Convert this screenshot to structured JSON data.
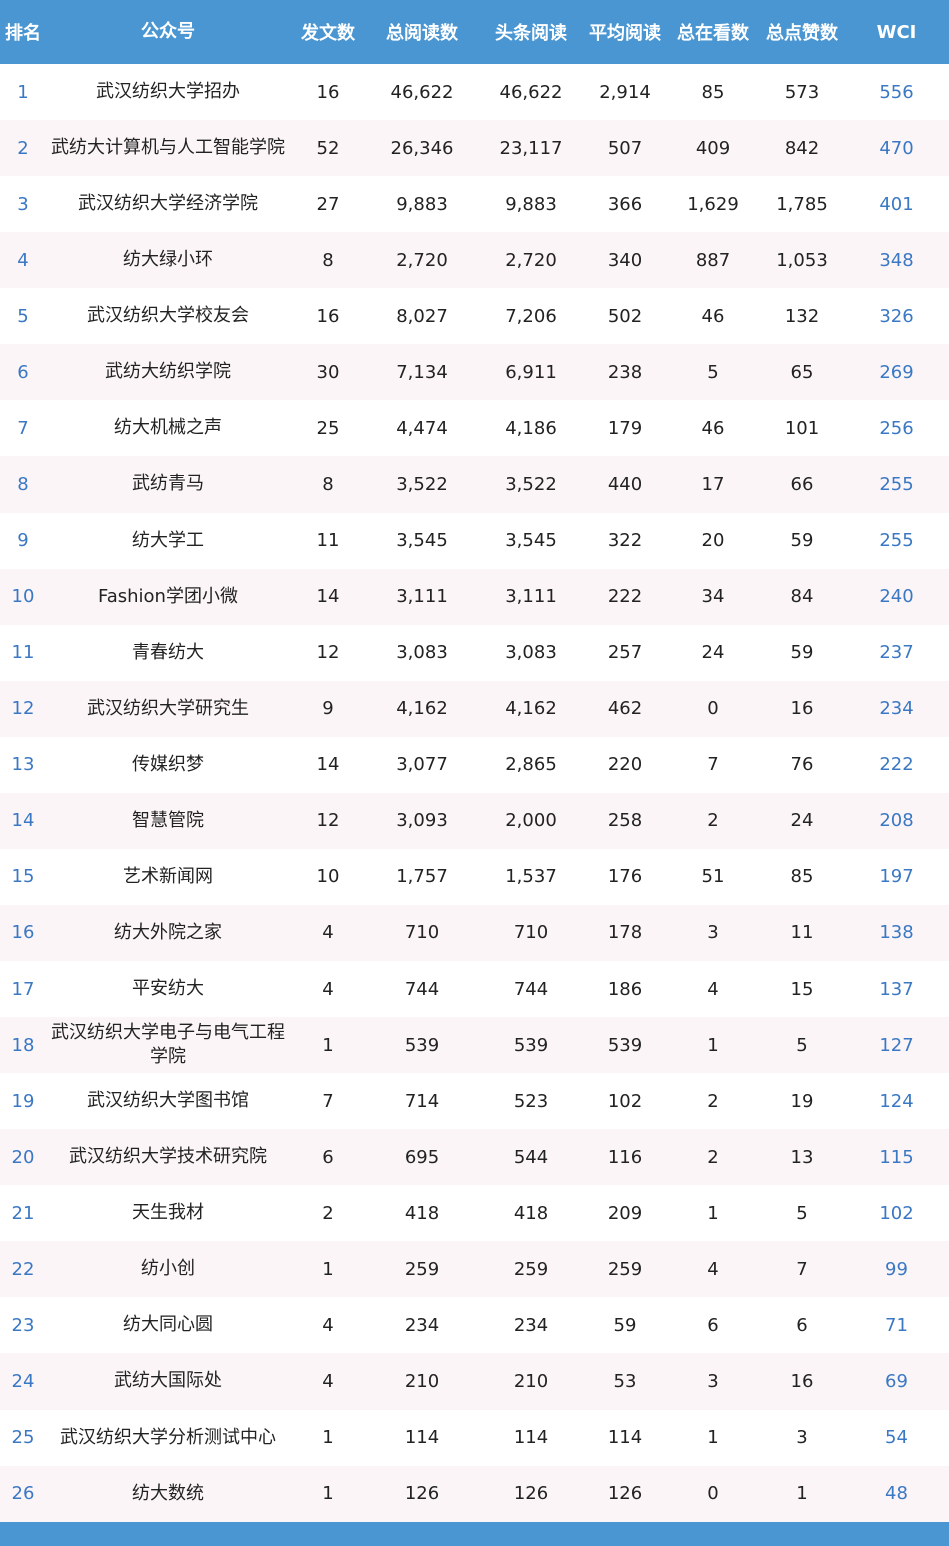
{
  "header": {
    "rank": "排名",
    "name": "公众号",
    "posts": "发文数",
    "total_reads": "总阅读数",
    "headline_reads": "头条阅读",
    "avg_reads": "平均阅读",
    "total_watching": "总在看数",
    "total_likes": "总点赞数",
    "wci": "WCI"
  },
  "rows": [
    {
      "rank": "1",
      "name": "武汉纺织大学招办",
      "posts": "16",
      "total_reads": "46,622",
      "headline_reads": "46,622",
      "avg_reads": "2,914",
      "total_watching": "85",
      "total_likes": "573",
      "wci": "556"
    },
    {
      "rank": "2",
      "name": "武纺大计算机与人工智能学院",
      "posts": "52",
      "total_reads": "26,346",
      "headline_reads": "23,117",
      "avg_reads": "507",
      "total_watching": "409",
      "total_likes": "842",
      "wci": "470"
    },
    {
      "rank": "3",
      "name": "武汉纺织大学经济学院",
      "posts": "27",
      "total_reads": "9,883",
      "headline_reads": "9,883",
      "avg_reads": "366",
      "total_watching": "1,629",
      "total_likes": "1,785",
      "wci": "401"
    },
    {
      "rank": "4",
      "name": "纺大绿小环",
      "posts": "8",
      "total_reads": "2,720",
      "headline_reads": "2,720",
      "avg_reads": "340",
      "total_watching": "887",
      "total_likes": "1,053",
      "wci": "348"
    },
    {
      "rank": "5",
      "name": "武汉纺织大学校友会",
      "posts": "16",
      "total_reads": "8,027",
      "headline_reads": "7,206",
      "avg_reads": "502",
      "total_watching": "46",
      "total_likes": "132",
      "wci": "326"
    },
    {
      "rank": "6",
      "name": "武纺大纺织学院",
      "posts": "30",
      "total_reads": "7,134",
      "headline_reads": "6,911",
      "avg_reads": "238",
      "total_watching": "5",
      "total_likes": "65",
      "wci": "269"
    },
    {
      "rank": "7",
      "name": "纺大机械之声",
      "posts": "25",
      "total_reads": "4,474",
      "headline_reads": "4,186",
      "avg_reads": "179",
      "total_watching": "46",
      "total_likes": "101",
      "wci": "256"
    },
    {
      "rank": "8",
      "name": "武纺青马",
      "posts": "8",
      "total_reads": "3,522",
      "headline_reads": "3,522",
      "avg_reads": "440",
      "total_watching": "17",
      "total_likes": "66",
      "wci": "255"
    },
    {
      "rank": "9",
      "name": "纺大学工",
      "posts": "11",
      "total_reads": "3,545",
      "headline_reads": "3,545",
      "avg_reads": "322",
      "total_watching": "20",
      "total_likes": "59",
      "wci": "255"
    },
    {
      "rank": "10",
      "name": "Fashion学团小微",
      "posts": "14",
      "total_reads": "3,111",
      "headline_reads": "3,111",
      "avg_reads": "222",
      "total_watching": "34",
      "total_likes": "84",
      "wci": "240"
    },
    {
      "rank": "11",
      "name": "青春纺大",
      "posts": "12",
      "total_reads": "3,083",
      "headline_reads": "3,083",
      "avg_reads": "257",
      "total_watching": "24",
      "total_likes": "59",
      "wci": "237"
    },
    {
      "rank": "12",
      "name": "武汉纺织大学研究生",
      "posts": "9",
      "total_reads": "4,162",
      "headline_reads": "4,162",
      "avg_reads": "462",
      "total_watching": "0",
      "total_likes": "16",
      "wci": "234"
    },
    {
      "rank": "13",
      "name": "传媒织梦",
      "posts": "14",
      "total_reads": "3,077",
      "headline_reads": "2,865",
      "avg_reads": "220",
      "total_watching": "7",
      "total_likes": "76",
      "wci": "222"
    },
    {
      "rank": "14",
      "name": "智慧管院",
      "posts": "12",
      "total_reads": "3,093",
      "headline_reads": "2,000",
      "avg_reads": "258",
      "total_watching": "2",
      "total_likes": "24",
      "wci": "208"
    },
    {
      "rank": "15",
      "name": "艺术新闻网",
      "posts": "10",
      "total_reads": "1,757",
      "headline_reads": "1,537",
      "avg_reads": "176",
      "total_watching": "51",
      "total_likes": "85",
      "wci": "197"
    },
    {
      "rank": "16",
      "name": "纺大外院之家",
      "posts": "4",
      "total_reads": "710",
      "headline_reads": "710",
      "avg_reads": "178",
      "total_watching": "3",
      "total_likes": "11",
      "wci": "138"
    },
    {
      "rank": "17",
      "name": "平安纺大",
      "posts": "4",
      "total_reads": "744",
      "headline_reads": "744",
      "avg_reads": "186",
      "total_watching": "4",
      "total_likes": "15",
      "wci": "137"
    },
    {
      "rank": "18",
      "name": "武汉纺织大学电子与电气工程学院",
      "posts": "1",
      "total_reads": "539",
      "headline_reads": "539",
      "avg_reads": "539",
      "total_watching": "1",
      "total_likes": "5",
      "wci": "127"
    },
    {
      "rank": "19",
      "name": "武汉纺织大学图书馆",
      "posts": "7",
      "total_reads": "714",
      "headline_reads": "523",
      "avg_reads": "102",
      "total_watching": "2",
      "total_likes": "19",
      "wci": "124"
    },
    {
      "rank": "20",
      "name": "武汉纺织大学技术研究院",
      "posts": "6",
      "total_reads": "695",
      "headline_reads": "544",
      "avg_reads": "116",
      "total_watching": "2",
      "total_likes": "13",
      "wci": "115"
    },
    {
      "rank": "21",
      "name": "天生我材",
      "posts": "2",
      "total_reads": "418",
      "headline_reads": "418",
      "avg_reads": "209",
      "total_watching": "1",
      "total_likes": "5",
      "wci": "102"
    },
    {
      "rank": "22",
      "name": "纺小创",
      "posts": "1",
      "total_reads": "259",
      "headline_reads": "259",
      "avg_reads": "259",
      "total_watching": "4",
      "total_likes": "7",
      "wci": "99"
    },
    {
      "rank": "23",
      "name": "纺大同心圆",
      "posts": "4",
      "total_reads": "234",
      "headline_reads": "234",
      "avg_reads": "59",
      "total_watching": "6",
      "total_likes": "6",
      "wci": "71"
    },
    {
      "rank": "24",
      "name": "武纺大国际处",
      "posts": "4",
      "total_reads": "210",
      "headline_reads": "210",
      "avg_reads": "53",
      "total_watching": "3",
      "total_likes": "16",
      "wci": "69"
    },
    {
      "rank": "25",
      "name": "武汉纺织大学分析测试中心",
      "posts": "1",
      "total_reads": "114",
      "headline_reads": "114",
      "avg_reads": "114",
      "total_watching": "1",
      "total_likes": "3",
      "wci": "54"
    },
    {
      "rank": "26",
      "name": "纺大数统",
      "posts": "1",
      "total_reads": "126",
      "headline_reads": "126",
      "avg_reads": "126",
      "total_watching": "0",
      "total_likes": "1",
      "wci": "48"
    }
  ],
  "colors": {
    "header_bg": "#4a96d2",
    "rank_and_wci_text": "#3a78c4",
    "even_row_bg": "#fbf5f8"
  }
}
